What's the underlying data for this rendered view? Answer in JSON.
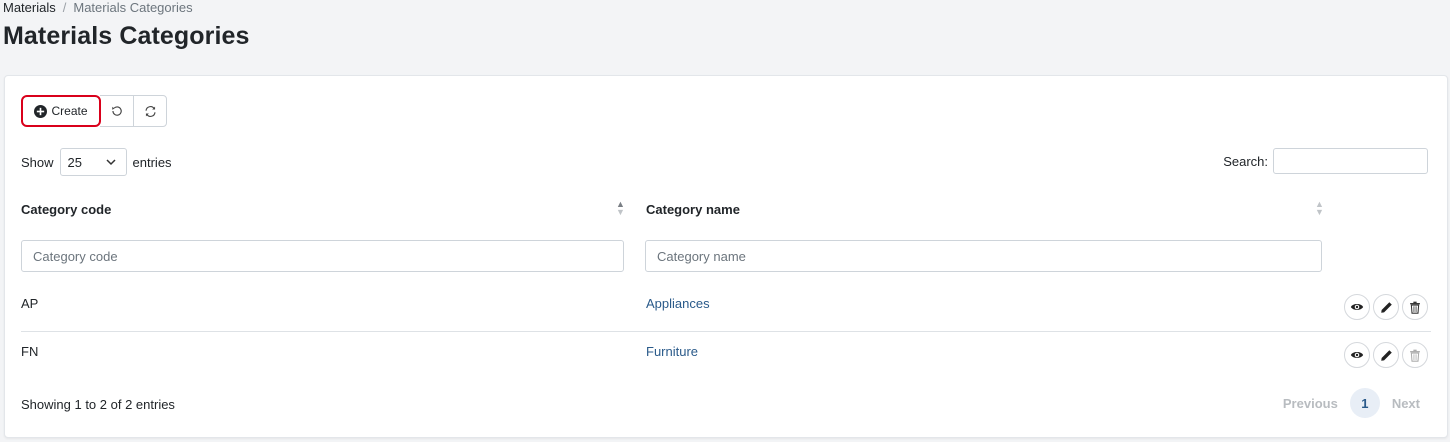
{
  "breadcrumb": {
    "root": "Materials",
    "separator": "/",
    "current": "Materials Categories"
  },
  "page": {
    "title": "Materials Categories"
  },
  "toolbar": {
    "create_label": "Create",
    "create_icon": "plus-circle-icon",
    "reset_icon": "undo-icon",
    "reload_icon": "refresh-icon"
  },
  "length": {
    "show_label": "Show",
    "value": "25",
    "entries_label": "entries"
  },
  "search": {
    "label": "Search:",
    "value": ""
  },
  "table": {
    "columns": [
      {
        "label": "Category code",
        "filter_placeholder": "Category code"
      },
      {
        "label": "Category name",
        "filter_placeholder": "Category name"
      }
    ],
    "rows": [
      {
        "code": "AP",
        "name": "Appliances",
        "delete_enabled": true
      },
      {
        "code": "FN",
        "name": "Furniture",
        "delete_enabled": false
      }
    ]
  },
  "footer": {
    "info": "Showing 1 to 2 of 2 entries",
    "previous": "Previous",
    "page": "1",
    "next": "Next"
  },
  "colors": {
    "link": "#2a5a8a",
    "highlight": "#d9001b",
    "page_bg": "#f3f4f6"
  }
}
